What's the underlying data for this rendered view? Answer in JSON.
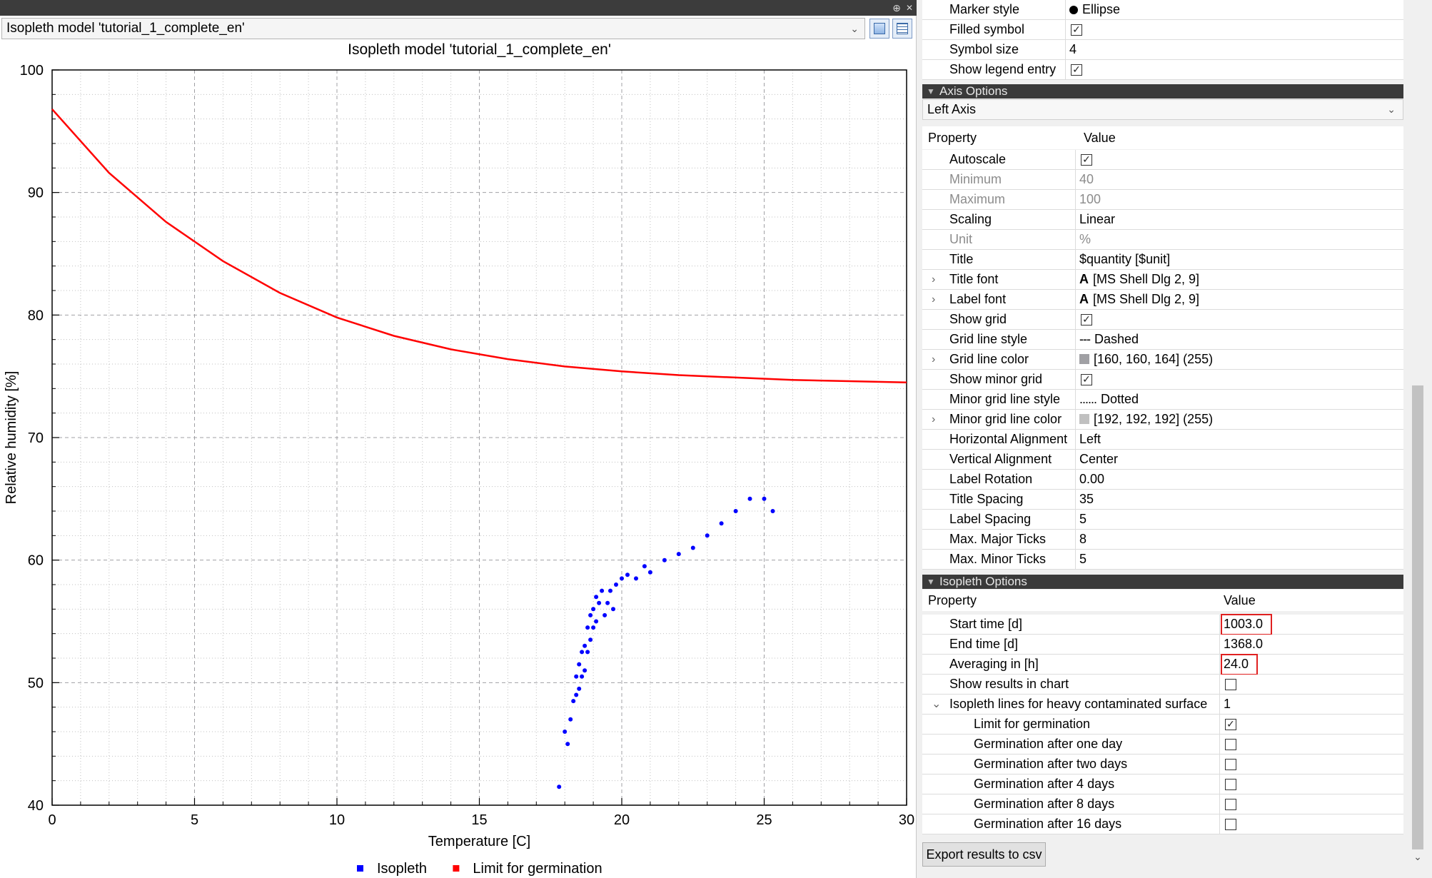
{
  "chart_panel": {
    "selected_model": "Isopleth model 'tutorial_1_complete_en'",
    "float_icon": "float-dock-icon",
    "close_icon": "close-icon"
  },
  "chart_data": {
    "type": "scatter",
    "title": "Isopleth model 'tutorial_1_complete_en'",
    "xlabel": "Temperature [C]",
    "ylabel": "Relative humidity [%]",
    "xlim": [
      0,
      30
    ],
    "ylim": [
      40,
      100
    ],
    "xticks": [
      "0",
      "5",
      "10",
      "15",
      "20",
      "25",
      "30"
    ],
    "yticks": [
      "40",
      "50",
      "60",
      "70",
      "80",
      "90",
      "100"
    ],
    "grid": true,
    "minor_grid": true,
    "legend_placement": "bottom",
    "series": [
      {
        "name": "Isopleth",
        "color": "#0000ff",
        "kind": "scatter",
        "x": [
          17.8,
          18.0,
          18.1,
          18.2,
          18.3,
          18.4,
          18.4,
          18.5,
          18.5,
          18.6,
          18.6,
          18.7,
          18.7,
          18.8,
          18.8,
          18.9,
          18.9,
          19.0,
          19.0,
          19.1,
          19.1,
          19.2,
          19.3,
          19.4,
          19.5,
          19.6,
          19.7,
          19.8,
          20.0,
          20.2,
          20.5,
          20.8,
          21.0,
          21.5,
          22.0,
          22.5,
          23.0,
          23.5,
          24.0,
          24.5,
          25.0,
          25.3
        ],
        "y": [
          41.5,
          46.0,
          45.0,
          47.0,
          48.5,
          49.0,
          50.5,
          49.5,
          51.5,
          50.5,
          52.5,
          51.0,
          53.0,
          52.5,
          54.5,
          53.5,
          55.5,
          54.5,
          56.0,
          55.0,
          57.0,
          56.5,
          57.5,
          55.5,
          56.5,
          57.5,
          56.0,
          58.0,
          58.5,
          58.8,
          58.5,
          59.5,
          59.0,
          60.0,
          60.5,
          61.0,
          62.0,
          63.0,
          64.0,
          65.0,
          65.0,
          64.0
        ]
      },
      {
        "name": "Limit for germination",
        "color": "#ff0000",
        "kind": "line",
        "x": [
          0,
          2,
          4,
          6,
          8,
          10,
          12,
          14,
          16,
          18,
          20,
          22,
          24,
          26,
          28,
          30
        ],
        "y": [
          96.8,
          91.6,
          87.6,
          84.4,
          81.8,
          79.8,
          78.3,
          77.2,
          76.4,
          75.8,
          75.4,
          75.1,
          74.9,
          74.7,
          74.6,
          74.5
        ]
      }
    ]
  },
  "props": {
    "top_rows": [
      {
        "label": "Marker style",
        "value": "Ellipse",
        "marker": true
      },
      {
        "label": "Filled symbol",
        "checked": true
      },
      {
        "label": "Symbol size",
        "value": "4"
      },
      {
        "label": "Show legend entry",
        "checked": true
      }
    ],
    "axis_section": {
      "title": "Axis Options",
      "selected_axis": "Left Axis",
      "col_property": "Property",
      "col_value": "Value",
      "rows": [
        {
          "label": "Autoscale",
          "checked": true
        },
        {
          "label": "Minimum",
          "value": "40",
          "disabled": true
        },
        {
          "label": "Maximum",
          "value": "100",
          "disabled": true
        },
        {
          "label": "Scaling",
          "value": "Linear"
        },
        {
          "label": "Unit",
          "value": "%",
          "disabled": true
        },
        {
          "label": "Title",
          "value": "$quantity [$unit]"
        },
        {
          "label": "Title font",
          "value": "[MS Shell Dlg 2, 9]",
          "expandable": true,
          "font_glyph": "A"
        },
        {
          "label": "Label font",
          "value": "[MS Shell Dlg 2, 9]",
          "expandable": true,
          "font_glyph": "A"
        },
        {
          "label": "Show grid",
          "checked": true
        },
        {
          "label": "Grid line style",
          "value": "Dashed",
          "line_glyph": "---"
        },
        {
          "label": "Grid line color",
          "value": "[160, 160, 164] (255)",
          "expandable": true,
          "swatch": "#a0a0a4"
        },
        {
          "label": "Show minor grid",
          "checked": true
        },
        {
          "label": "Minor grid line style",
          "value": "Dotted",
          "line_glyph": "......"
        },
        {
          "label": "Minor grid line color",
          "value": "[192, 192, 192] (255)",
          "expandable": true,
          "swatch": "#c0c0c0"
        },
        {
          "label": "Horizontal Alignment",
          "value": "Left"
        },
        {
          "label": "Vertical Alignment",
          "value": "Center"
        },
        {
          "label": "Label Rotation",
          "value": "0.00"
        },
        {
          "label": "Title Spacing",
          "value": "35"
        },
        {
          "label": "Label Spacing",
          "value": "5"
        },
        {
          "label": "Max. Major Ticks",
          "value": "8"
        },
        {
          "label": "Max. Minor Ticks",
          "value": "5"
        }
      ]
    },
    "isopleth_section": {
      "title": "Isopleth Options",
      "col_property": "Property",
      "col_value": "Value",
      "rows": [
        {
          "label": "Start time [d]",
          "value": "1003.0",
          "highlight": true
        },
        {
          "label": "End time [d]",
          "value": "1368.0"
        },
        {
          "label": "Averaging in [h]",
          "value": "24.0",
          "highlight": true
        },
        {
          "label": "Show results in chart",
          "checked": false
        },
        {
          "label": "Isopleth lines for heavy contaminated surface",
          "value": "1",
          "expanded": true
        },
        {
          "label": "Limit for germination",
          "checked": true,
          "indent": true
        },
        {
          "label": "Germination after one day",
          "checked": false,
          "indent": true
        },
        {
          "label": "Germination after two days",
          "checked": false,
          "indent": true
        },
        {
          "label": "Germination after 4 days",
          "checked": false,
          "indent": true
        },
        {
          "label": "Germination after 8 days",
          "checked": false,
          "indent": true
        },
        {
          "label": "Germination after 16 days",
          "checked": false,
          "indent": true
        }
      ]
    },
    "export_button": "Export results to csv"
  },
  "colors": {
    "section_header": "#3a3a3a",
    "highlight_box": "#e02020",
    "isopleth_points": "#0000ff",
    "limit_line": "#ff0000"
  }
}
